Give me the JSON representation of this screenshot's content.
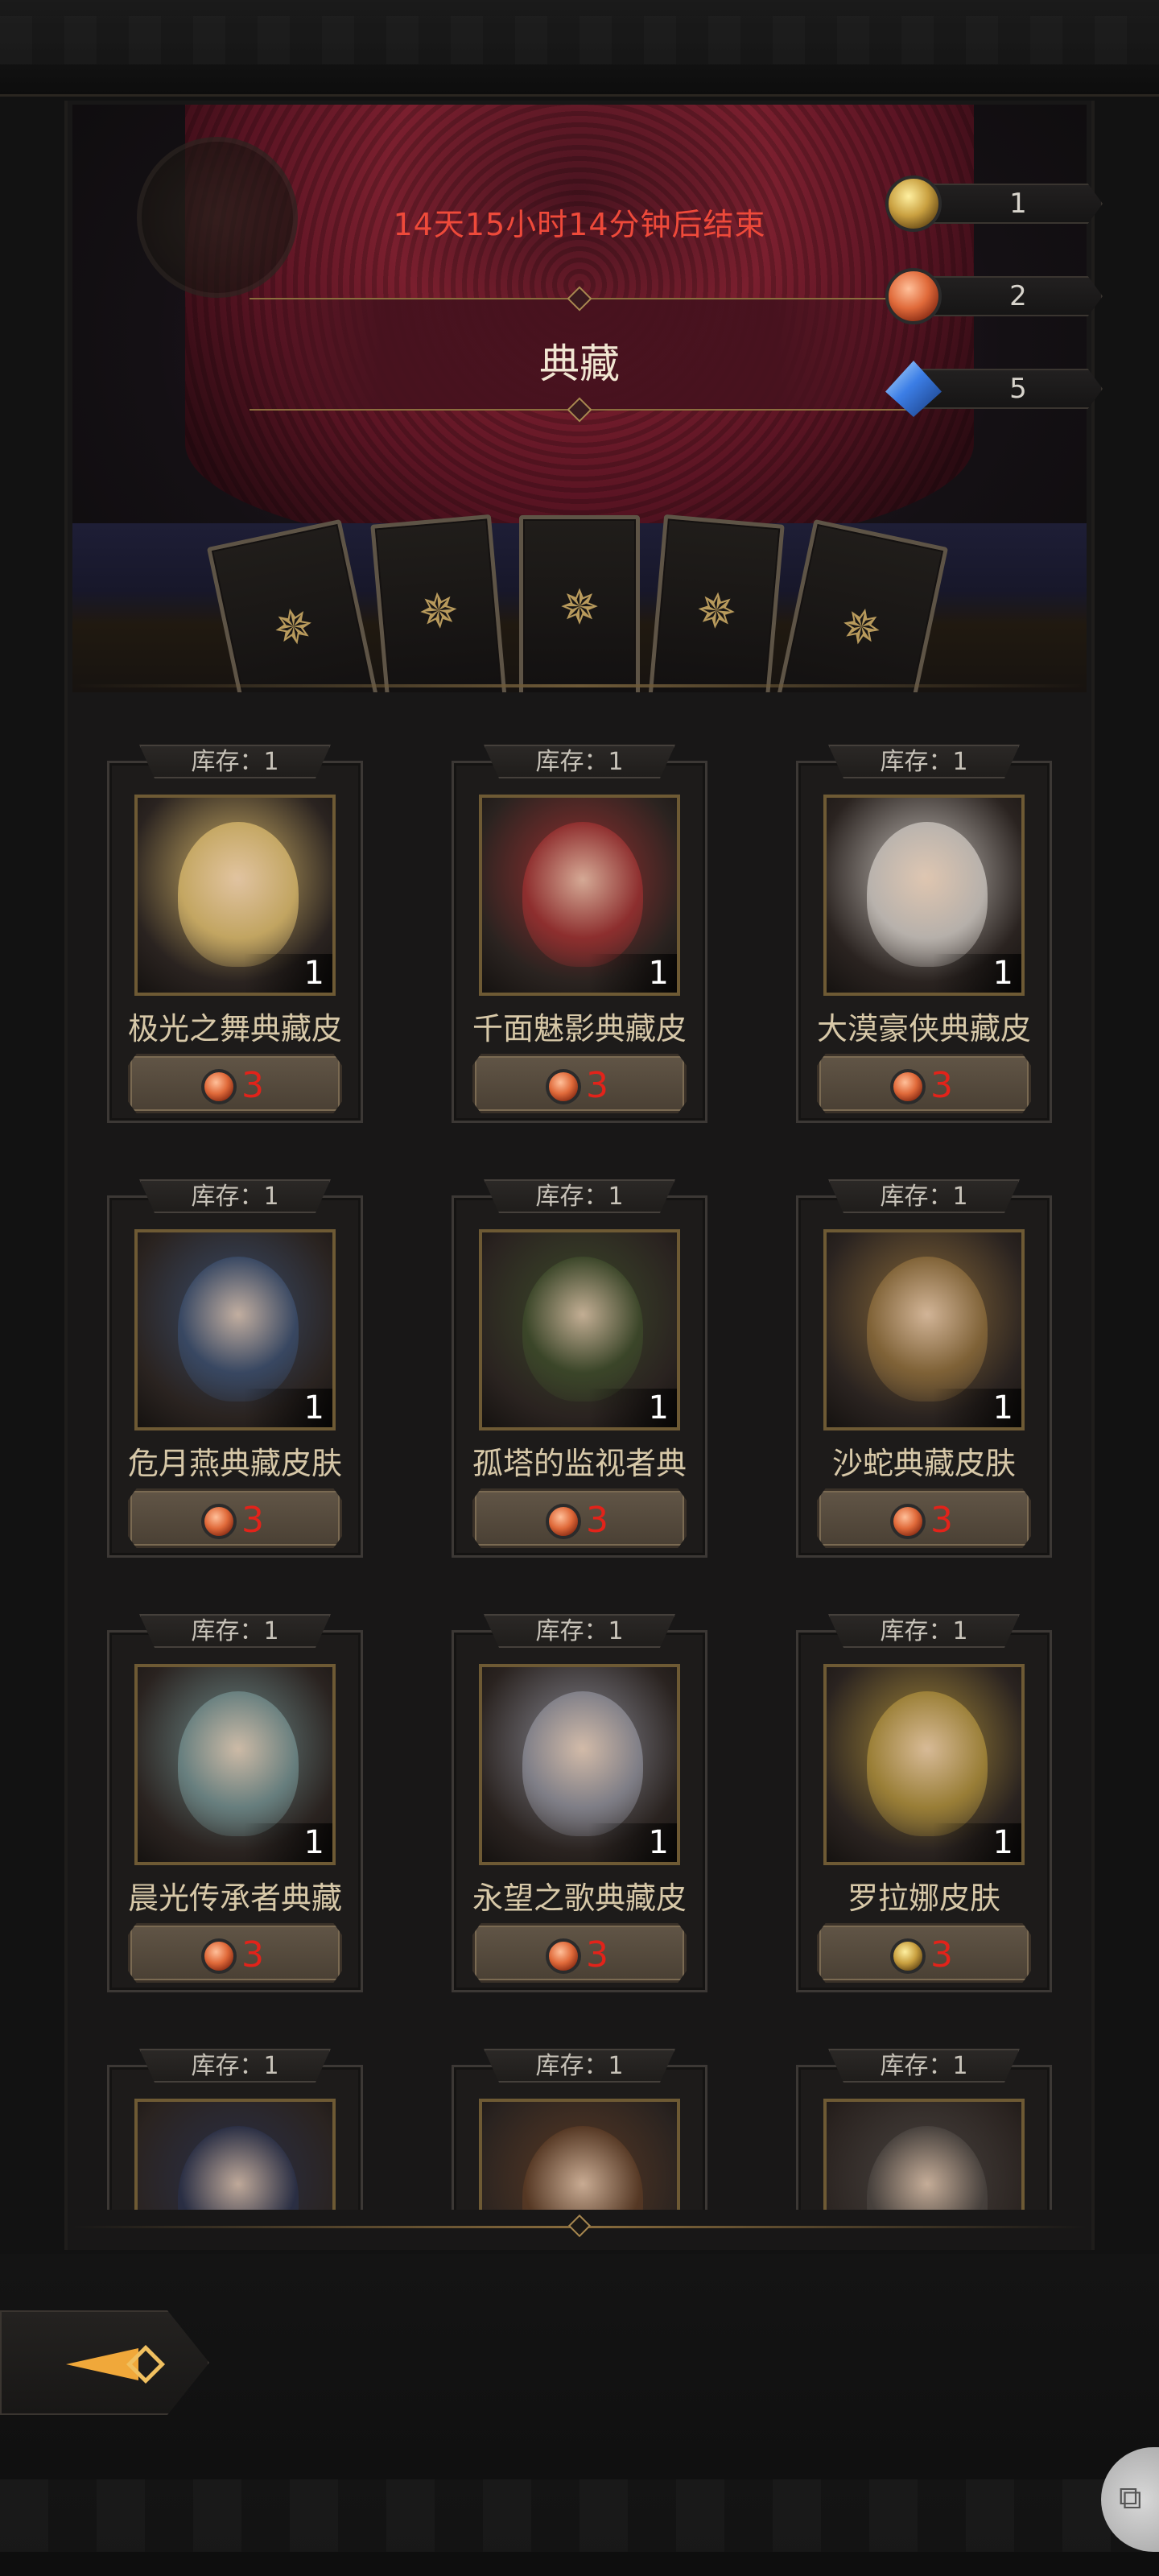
{
  "header": {
    "timer_text": "14天15小时14分钟后结束",
    "title": "典藏"
  },
  "currencies": [
    {
      "icon": "gold-coin-icon",
      "value": "1"
    },
    {
      "icon": "red-coin-icon",
      "value": "2"
    },
    {
      "icon": "blue-gem-icon",
      "value": "5"
    }
  ],
  "items": [
    {
      "stock": "库存：1",
      "qty": "1",
      "name": "极光之舞典藏皮",
      "price": "3",
      "currency_icon": "red-coin-icon",
      "tint": "#d6b66a"
    },
    {
      "stock": "库存：1",
      "qty": "1",
      "name": "千面魅影典藏皮",
      "price": "3",
      "currency_icon": "red-coin-icon",
      "tint": "#9a3030"
    },
    {
      "stock": "库存：1",
      "qty": "1",
      "name": "大漠豪侠典藏皮",
      "price": "3",
      "currency_icon": "red-coin-icon",
      "tint": "#c9c3bd"
    },
    {
      "stock": "库存：1",
      "qty": "1",
      "name": "危月燕典藏皮肤",
      "price": "3",
      "currency_icon": "red-coin-icon",
      "tint": "#3a4c6a"
    },
    {
      "stock": "库存：1",
      "qty": "1",
      "name": "孤塔的监视者典",
      "price": "3",
      "currency_icon": "red-coin-icon",
      "tint": "#3d4a2a"
    },
    {
      "stock": "库存：1",
      "qty": "1",
      "name": "沙蛇典藏皮肤",
      "price": "3",
      "currency_icon": "red-coin-icon",
      "tint": "#8a6a3a"
    },
    {
      "stock": "库存：1",
      "qty": "1",
      "name": "晨光传承者典藏",
      "price": "3",
      "currency_icon": "red-coin-icon",
      "tint": "#6f8a8a"
    },
    {
      "stock": "库存：1",
      "qty": "1",
      "name": "永望之歌典藏皮",
      "price": "3",
      "currency_icon": "red-coin-icon",
      "tint": "#8a8a94"
    },
    {
      "stock": "库存：1",
      "qty": "1",
      "name": "罗拉娜皮肤",
      "price": "3",
      "currency_icon": "gold-coin-icon",
      "tint": "#a88a3a"
    },
    {
      "stock": "库存：1",
      "qty": "",
      "name": "",
      "price": "",
      "currency_icon": "red-coin-icon",
      "tint": "#2a3048"
    },
    {
      "stock": "库存：1",
      "qty": "",
      "name": "",
      "price": "",
      "currency_icon": "red-coin-icon",
      "tint": "#5a3a24"
    },
    {
      "stock": "库存：1",
      "qty": "",
      "name": "",
      "price": "",
      "currency_icon": "red-coin-icon",
      "tint": "#4a4440"
    }
  ],
  "nav": {
    "back_icon": "back-arrow-icon",
    "float_icon": "assistant-icon",
    "float_glyph": "⧉"
  },
  "colors": {
    "timer": "#ef4a3a",
    "price": "#e2231a",
    "accent_gold": "#8a6d3d"
  }
}
